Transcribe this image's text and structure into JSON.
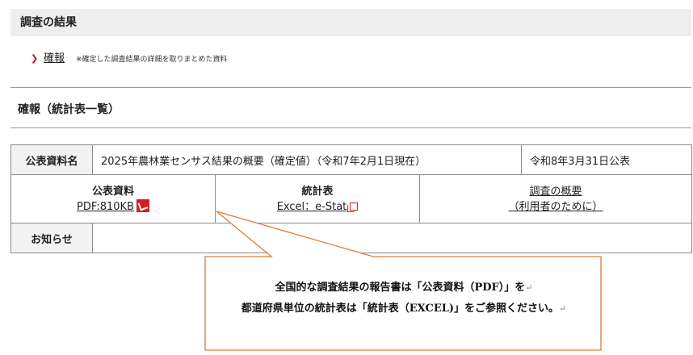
{
  "section": {
    "title": "調査の結果"
  },
  "report": {
    "link_label": "確報",
    "note": "※確定した調査結果の詳細を取りまとめた資料"
  },
  "subheading": "確報（統計表一覧）",
  "table": {
    "row1": {
      "label": "公表資料名",
      "name": "2025年農林業センサス結果の概要（確定値）（令和7年2月1日現在）",
      "date": "令和8年3月31日公表"
    },
    "row2": {
      "pub_title": "公表資料",
      "pub_link": "PDF:810KB",
      "stat_title": "統計表",
      "stat_link": "Excel：e-Stat",
      "overview_line1": "調査の概要",
      "overview_line2": "（利用者のために）"
    },
    "row3": {
      "label": "お知らせ",
      "value": ""
    }
  },
  "callout": {
    "line1": "全国的な調査結果の報告書は「公表資料（PDF）」を",
    "line2": "都道府県単位の統計表は「統計表（EXCEL)」をご参照ください。",
    "para_mark": "↵"
  },
  "colors": {
    "accent_red": "#d21f1f",
    "callout_border": "#e07b39",
    "header_bg": "#eeeeee"
  },
  "icons": {
    "chevron": "chevron-right-icon",
    "pdf": "pdf-icon",
    "external": "external-link-icon"
  }
}
